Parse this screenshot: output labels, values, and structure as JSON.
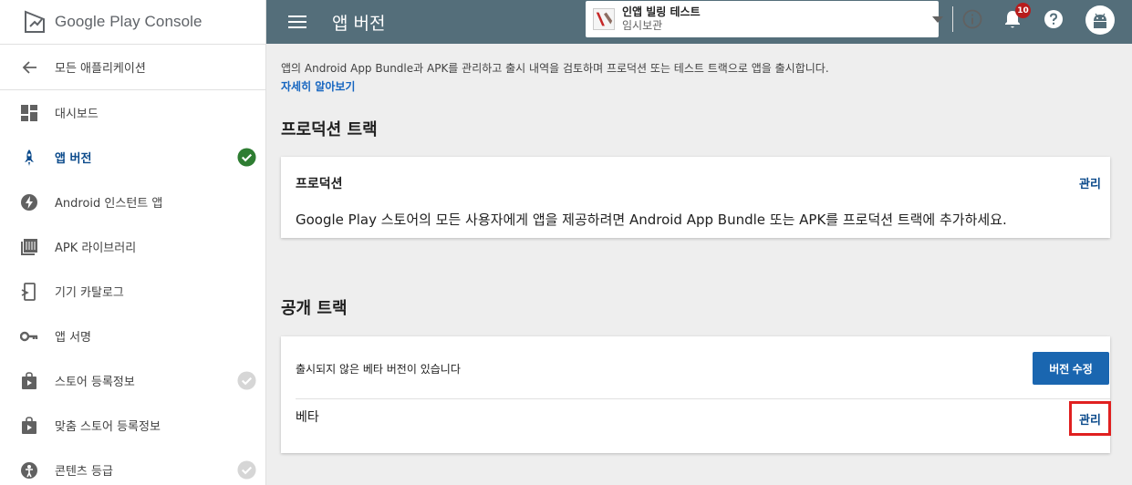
{
  "brand": {
    "name": "Google Play Console"
  },
  "sidebar": {
    "back_label": "모든 애플리케이션",
    "items": [
      {
        "label": "대시보드",
        "icon": "dashboard-icon"
      },
      {
        "label": "앱 버전",
        "icon": "rocket-icon",
        "active": true,
        "status": "complete"
      },
      {
        "label": "Android 인스턴트 앱",
        "icon": "bolt-icon"
      },
      {
        "label": "APK 라이브러리",
        "icon": "library-icon"
      },
      {
        "label": "기기 카탈로그",
        "icon": "device-icon"
      },
      {
        "label": "앱 서명",
        "icon": "key-icon"
      },
      {
        "label": "스토어 등록정보",
        "icon": "store-icon",
        "status": "incomplete"
      },
      {
        "label": "맞춤 스토어 등록정보",
        "icon": "store-play-icon"
      },
      {
        "label": "콘텐츠 등급",
        "icon": "rating-icon",
        "status": "incomplete"
      }
    ]
  },
  "topbar": {
    "title": "앱 버전",
    "app_name": "인앱 빌링 테스트",
    "app_status": "임시보관",
    "notification_count": "10"
  },
  "main": {
    "intro": "앱의 Android App Bundle과 APK를 관리하고 출시 내역을 검토하며 프로덕션 또는 테스트 트랙으로 앱을 출시합니다.",
    "learn_more": "자세히 알아보기",
    "production_section": "프로덕션 트랙",
    "production_card": {
      "title": "프로덕션",
      "manage": "관리",
      "description": "Google Play 스토어의 모든 사용자에게 앱을 제공하려면 Android App Bundle 또는 APK를 프로덕션 트랙에 추가하세요."
    },
    "open_section": "공개 트랙",
    "beta_card": {
      "message": "출시되지 않은 베타 버전이 있습니다",
      "edit_button": "버전 수정",
      "track_name": "베타",
      "manage": "관리"
    }
  },
  "colors": {
    "topbar": "#546e7a",
    "accent": "#1a66b0",
    "link": "#0b4a8b",
    "check_green": "#2e7d32",
    "badge_red": "#b71c1c",
    "highlight_red": "#e02020"
  }
}
